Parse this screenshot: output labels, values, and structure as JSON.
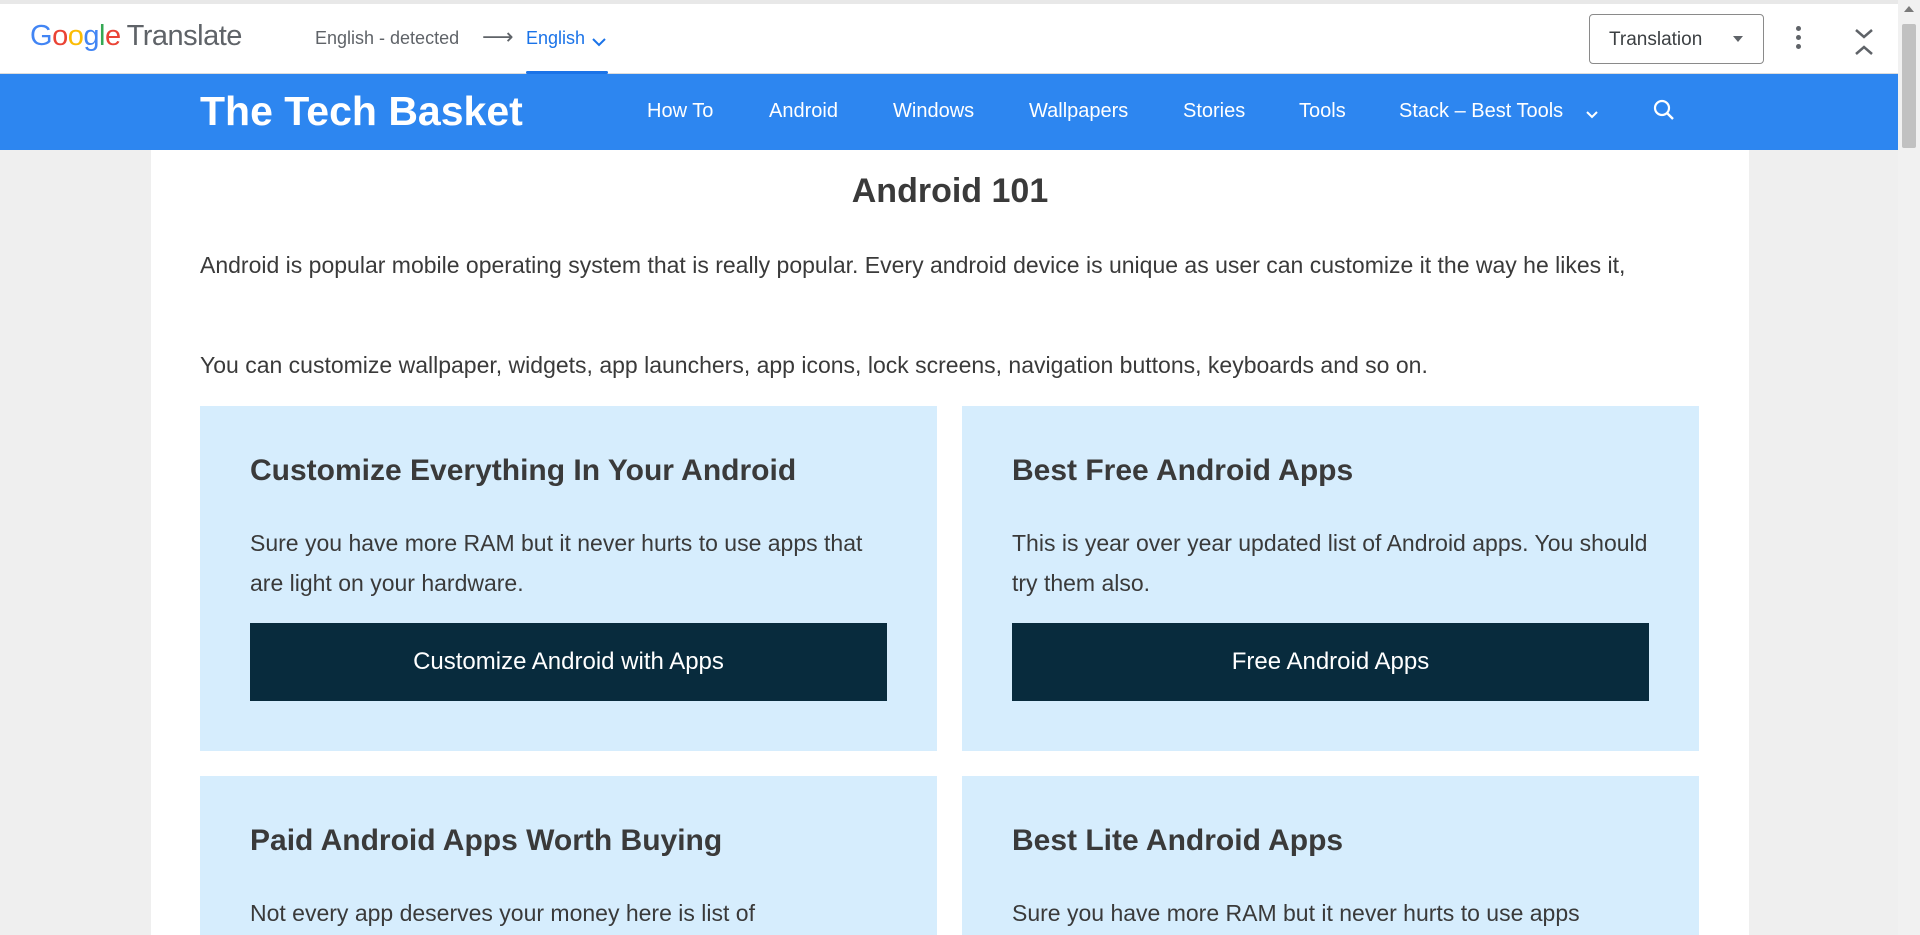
{
  "translate_bar": {
    "logo_google": [
      "G",
      "o",
      "o",
      "g",
      "l",
      "e"
    ],
    "logo_product": "Translate",
    "source_language": "English - detected",
    "arrow": "⟶",
    "target_language": "English",
    "view_select": "Translation"
  },
  "site": {
    "title": "The Tech Basket",
    "nav": [
      "How To",
      "Android",
      "Windows",
      "Wallpapers",
      "Stories",
      "Tools",
      "Stack – Best Tools"
    ]
  },
  "content": {
    "page_title": "Android 101",
    "intro_paragraph_1": "Android is popular mobile operating system that is really popular. Every android device is unique as user can customize it the way he likes it,",
    "intro_paragraph_2": "You can customize wallpaper, widgets, app launchers, app icons, lock screens, navigation buttons, keyboards and so on.",
    "cards": [
      {
        "title": "Customize Everything In Your Android",
        "text": "Sure you have more RAM but it never hurts to use apps that are light on your hardware.",
        "button": "Customize Android with Apps"
      },
      {
        "title": "Best Free Android Apps",
        "text": "This is year over year updated list of Android apps. You should try them also.",
        "button": "Free Android Apps"
      },
      {
        "title": "Paid Android Apps Worth Buying",
        "text": "Not every app deserves your money here is list of",
        "button": ""
      },
      {
        "title": "Best Lite Android Apps",
        "text": "Sure you have more RAM but it never hurts to use apps",
        "button": ""
      }
    ]
  },
  "colors": {
    "header_blue": "#2d86f0",
    "card_bg": "#d6edfd",
    "button_bg": "#082b3d",
    "translate_accent": "#1a73e8"
  },
  "icons": {
    "language_dropdown": "chevron-down-icon",
    "more_options": "more-vertical-icon",
    "collapse": "collapse-icon",
    "nav_submenu": "chevron-down-icon",
    "search": "search-icon"
  }
}
